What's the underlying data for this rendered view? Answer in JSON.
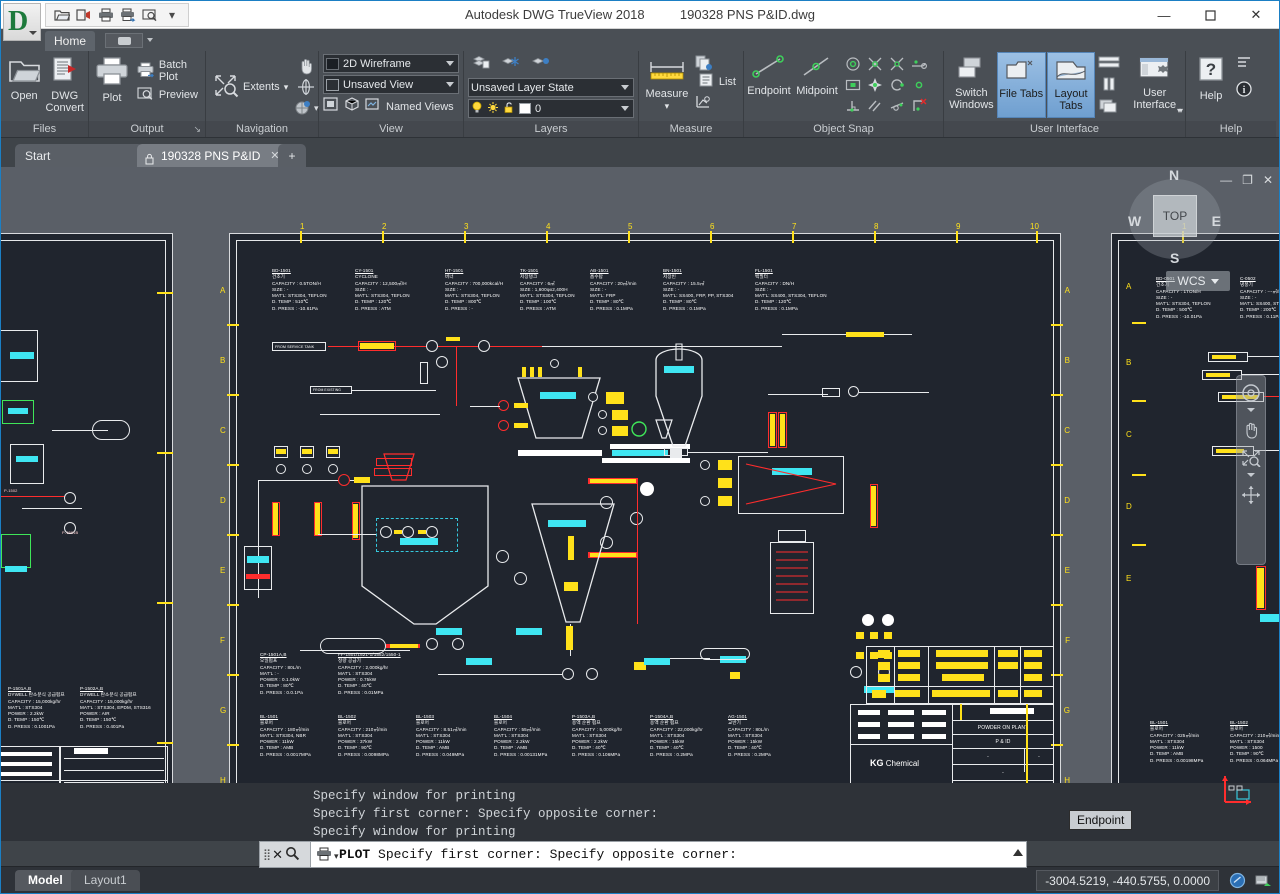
{
  "window": {
    "title": "Autodesk DWG TrueView 2018",
    "document": "190328 PNS P&ID.dwg",
    "minimize": "—",
    "maximize": "▢",
    "close": "✕"
  },
  "quick_access": {
    "icons": [
      {
        "name": "open-icon",
        "glyph": "🗁"
      },
      {
        "name": "edrawing-icon",
        "glyph": "▤"
      },
      {
        "name": "plot-icon",
        "glyph": "🖨"
      },
      {
        "name": "batch-plot-icon",
        "glyph": "🖶"
      },
      {
        "name": "preview-icon",
        "glyph": "🔍"
      },
      {
        "name": "qat-dropdown-icon",
        "glyph": "▾"
      }
    ]
  },
  "ribbon": {
    "tab_home": "Home",
    "panels": [
      {
        "title": "Files",
        "buttons": [
          {
            "label": "Open",
            "icon": "folder-open-icon"
          },
          {
            "label": "DWG\nConvert",
            "icon": "dwg-convert-icon"
          }
        ]
      },
      {
        "title": "Output",
        "buttons": [
          {
            "label": "Plot",
            "icon": "printer-icon"
          },
          {
            "label": "Batch Plot",
            "icon": "batch-plot-icon"
          },
          {
            "label": "Preview",
            "icon": "preview-icon"
          }
        ]
      },
      {
        "title": "Navigation",
        "buttons": [
          {
            "label": "Extents",
            "icon": "zoom-extents-icon"
          },
          {
            "label": "",
            "icon": "pan-hand-icon"
          },
          {
            "label": "",
            "icon": "orbit-icon"
          },
          {
            "label": "",
            "icon": "steering-wheel-icon"
          }
        ]
      },
      {
        "title": "View",
        "combos": [
          {
            "value": "2D Wireframe",
            "icon": "visual-style-icon"
          },
          {
            "value": "Unsaved View",
            "icon": "view-icon"
          }
        ],
        "buttons": [
          {
            "label": "Named Views",
            "icon": "named-views-icon"
          },
          {
            "label": "",
            "icon": "viewport-config-icon"
          },
          {
            "label": "",
            "icon": "isometric-icon"
          }
        ]
      },
      {
        "title": "Layers",
        "combos": [
          {
            "value": "Unsaved Layer State",
            "icon": "layer-state-icon"
          },
          {
            "value": "0",
            "icon": "layer-icon"
          }
        ],
        "buttons": [
          {
            "label": "",
            "icon": "layer-properties-icon"
          },
          {
            "label": "",
            "icon": "layer-freeze-icon"
          },
          {
            "label": "",
            "icon": "layer-off-icon"
          }
        ]
      },
      {
        "title": "Measure",
        "buttons": [
          {
            "label": "Measure",
            "icon": "measure-ruler-icon"
          },
          {
            "label": "List",
            "icon": "list-icon"
          },
          {
            "label": "",
            "icon": "copy-clip-icon"
          },
          {
            "label": "",
            "icon": "area-icon"
          }
        ]
      },
      {
        "title": "Object Snap",
        "buttons": [
          {
            "label": "Endpoint",
            "icon": "osnap-endpoint-icon"
          },
          {
            "label": "Midpoint",
            "icon": "osnap-midpoint-icon"
          },
          {
            "label": "",
            "icon": "osnap-center-icon"
          },
          {
            "label": "",
            "icon": "osnap-intersection-icon"
          },
          {
            "label": "",
            "icon": "osnap-apparent-intersection-icon"
          },
          {
            "label": "",
            "icon": "osnap-extension-icon"
          },
          {
            "label": "",
            "icon": "osnap-insertion-icon"
          },
          {
            "label": "",
            "icon": "osnap-node-icon"
          },
          {
            "label": "",
            "icon": "osnap-quadrant-icon"
          },
          {
            "label": "",
            "icon": "osnap-nearest-icon"
          },
          {
            "label": "",
            "icon": "osnap-perpendicular-icon"
          },
          {
            "label": "",
            "icon": "osnap-parallel-icon"
          },
          {
            "label": "",
            "icon": "osnap-tangent-icon"
          },
          {
            "label": "",
            "icon": "osnap-none-icon"
          }
        ]
      },
      {
        "title": "User Interface",
        "buttons": [
          {
            "label": "Switch\nWindows",
            "icon": "switch-windows-icon"
          },
          {
            "label": "File Tabs",
            "icon": "file-tabs-icon",
            "active": true
          },
          {
            "label": "Layout\nTabs",
            "icon": "layout-tabs-icon",
            "active": true
          },
          {
            "label": "User\nInterface",
            "icon": "user-interface-icon"
          },
          {
            "label": "",
            "icon": "command-line-icon"
          },
          {
            "label": "",
            "icon": "status-bar-icon"
          },
          {
            "label": "",
            "icon": "cascade-icon"
          }
        ]
      },
      {
        "title": "Help",
        "buttons": [
          {
            "label": "Help",
            "icon": "help-question-icon"
          },
          {
            "label": "",
            "icon": "about-info-icon"
          },
          {
            "label": "",
            "icon": "help-list-icon"
          }
        ]
      }
    ]
  },
  "file_tabs": [
    {
      "label": "Start",
      "active": false,
      "locked": false
    },
    {
      "label": "190328 PNS P&ID",
      "active": true,
      "locked": true,
      "close": "✕"
    },
    {
      "label": "+",
      "active": false,
      "locked": false
    }
  ],
  "drawing_window": {
    "minimize": "—",
    "restore": "❐",
    "close": "✕"
  },
  "viewcube": {
    "face": "TOP",
    "north": "N",
    "south": "S",
    "west": "W",
    "east": "E",
    "ucs": "WCS"
  },
  "navbar": {
    "items": [
      {
        "name": "steering-wheel-icon",
        "glyph": "◎"
      },
      {
        "name": "pan-icon",
        "glyph": "✋"
      },
      {
        "name": "zoom-icon",
        "glyph": "⌕"
      },
      {
        "name": "orbit-icon",
        "glyph": "✥"
      }
    ]
  },
  "tooltip": {
    "endpoint": "Endpoint"
  },
  "command_line": {
    "history": [
      "Specify window for printing",
      "Specify first corner: Specify opposite corner:",
      "Specify window for printing"
    ],
    "prompt_command": "PLOT",
    "prompt_text": "Specify first corner: Specify opposite corner:",
    "close_icon": "✕",
    "search_icon": "🔍",
    "app_icon": "🖨",
    "expand_icon": "▲"
  },
  "status_bar": {
    "model_tab": "Model",
    "layout_tab": "Layout1",
    "coordinates": "-3004.5219, -440.5755, 0.0000",
    "icons": [
      {
        "name": "customization-icon",
        "glyph": "◔"
      },
      {
        "name": "annotation-scale-icon",
        "glyph": "▥"
      }
    ]
  },
  "drawing": {
    "grid_labels_top": [
      "1",
      "2",
      "3",
      "4",
      "5",
      "6",
      "7",
      "8",
      "9",
      "10"
    ],
    "grid_labels_left": [
      "A",
      "B",
      "C",
      "D",
      "E",
      "F",
      "G",
      "H"
    ],
    "equipment_notes_top": [
      {
        "tag": "BD-1501",
        "name": "건조기",
        "lines": [
          "CAPACITY : 0.5TON/H",
          "SIZE : -",
          "MAT'L: STS304, TEFLON",
          "D. TEMP : 510℃",
          "D. PRESS : -10.61Pa"
        ]
      },
      {
        "tag": "CY-1501",
        "name": "CYCLONE",
        "lines": [
          "CAPACITY : 12,500㎥/H",
          "SIZE : -",
          "MAT'L: STS304, TEFLON",
          "D. TEMP : 120℃",
          "D. PRESS : ATM"
        ]
      },
      {
        "tag": "HT-1501",
        "name": "버너",
        "lines": [
          "CAPACITY : 700,000kcal/H",
          "SIZE : -",
          "MAT'L: STS304, TEFLON",
          "D. TEMP : 800℃",
          "D. PRESS : -"
        ]
      },
      {
        "tag": "TK-1501",
        "name": "저장탱크",
        "lines": [
          "CAPACITY : 6㎥",
          "SIZE : 1,600φx2,400H",
          "MAT'L: STS304, TEFLON",
          "D. TEMP : 100℃",
          "D. PRESS : ATM"
        ]
      },
      {
        "tag": "AB-1501",
        "name": "흡수탑",
        "lines": [
          "CAPACITY : 20㎥/min",
          "SIZE : -",
          "MAT'L: FRP",
          "D. TEMP : 80℃",
          "D. PRESS : 0.1MPa"
        ]
      },
      {
        "tag": "BN-1501",
        "name": "저장빈",
        "lines": [
          "CAPACITY : 15.5㎥",
          "SIZE : -",
          "MAT'L: SS400, FRP, PP, STS304",
          "D. TEMP : 80℃",
          "D. PRESS : 0.1MPa"
        ]
      },
      {
        "tag": "FL-1501",
        "name": "백필터",
        "lines": [
          "CAPACITY : DN/H",
          "SIZE : -",
          "MAT'L: SS400, STS304, TEFLON",
          "D. TEMP : 120℃",
          "D. PRESS : 0.1MPa"
        ]
      }
    ],
    "equipment_notes_bottom": [
      {
        "tag": "CP-1501A,B",
        "name": "오일펌프",
        "lines": [
          "CAPACITY : 80L/m",
          "MAT'L : -",
          "POWER : 0.1.0kW",
          "D. TEMP : 80℃",
          "D. PRESS : 0.0.1Pa"
        ]
      },
      {
        "tag": "FF-1501/1521-1/1552/1550-1",
        "name": "정량 공급기",
        "lines": [
          "CAPACITY : 2,000kg/hr",
          "MAT'L : STS304",
          "POWER : 0.75kW",
          "D. TEMP : 40℃",
          "D. PRESS : 0.01MPa"
        ]
      },
      {
        "tag": "BL-1501",
        "name": "블로어",
        "lines": [
          "CAPACITY : 180㎥/min",
          "MAT'L: STS304, NBR",
          "POWER : 11kW",
          "D. TEMP : AMB",
          "D. PRESS : 0.0017MPa"
        ]
      },
      {
        "tag": "BL-1502",
        "name": "블로어",
        "lines": [
          "CAPACITY : 210㎥/min",
          "MAT'L : STS304",
          "POWER : 37kW",
          "D. TEMP : 90℃",
          "D. PRESS : 0.0098MPa"
        ]
      },
      {
        "tag": "BL-1503",
        "name": "블로어",
        "lines": [
          "CAPACITY : 8.51㎥/min",
          "MAT'L : STS304",
          "POWER : 11kW",
          "D. TEMP : AMB",
          "D. PRESS : 0.049MPa"
        ]
      },
      {
        "tag": "BL-1504",
        "name": "블로어",
        "lines": [
          "CAPACITY : 55㎥/min",
          "MAT'L : STS304",
          "POWER : 2.2kW",
          "D. TEMP : AMB",
          "D. PRESS : 0.00131MPa"
        ]
      },
      {
        "tag": "P-1503A,B",
        "name": "용액 순환 펌프",
        "lines": [
          "CAPACITY : 5,000kg/hr",
          "MAT'L : STS304",
          "POWER : 2.2kW",
          "D. TEMP : 40℃",
          "D. PRESS : 0.106MPa"
        ]
      },
      {
        "tag": "P-1504A,B",
        "name": "용액 순환 펌프",
        "lines": [
          "CAPACITY : 22,000kg/hr",
          "MAT'L : STS304",
          "POWER : 15kW",
          "D. TEMP : 40℃",
          "D. PRESS : 0.2MPa"
        ]
      },
      {
        "tag": "AG-1501",
        "name": "교반기",
        "lines": [
          "CAPACITY : 80L/m",
          "MAT'L : STS304",
          "POWER : 15kW",
          "D. TEMP : 40℃",
          "D. PRESS : 0.2MPa"
        ]
      }
    ],
    "title_block": {
      "project": "POWDER ON PLANT",
      "drawing_type": "P & ID",
      "company": "Chemical",
      "company_mark": "KG"
    },
    "left_panel_notes": [
      {
        "tag": "P-1501A,B",
        "name": "DYWELL 탄소분식 공급펌프",
        "lines": [
          "CAPACITY : 15,000kg/hr",
          "MAT'L : STS304",
          "POWER : 2.2kW",
          "D. TEMP : 150℃",
          "D. PRESS : 0.1001Pa"
        ]
      },
      {
        "tag": "P-1502A,B",
        "name": "DYWELL 탄소분식 공급펌프",
        "lines": [
          "CAPACITY : 15,000kg/hr",
          "MAT'L : STS304, EPDM, STS316",
          "POWER : AIR",
          "D. TEMP : 150℃",
          "D. PRESS : 0.401Pa"
        ]
      }
    ],
    "right_panel_notes": [
      {
        "tag": "BD-0501",
        "name": "건조기",
        "lines": [
          "CAPACITY : 1TON/H",
          "SIZE : -",
          "MAT'L: STS304, TEFLON",
          "D. TEMP : 500℃",
          "D. PRESS : -10.01Pa"
        ]
      },
      {
        "tag": "C-0502",
        "name": "냉풍기",
        "lines": [
          "CAPACITY : ---㎥/H",
          "SIZE : -",
          "MAT'L: SS400, STS304",
          "D. TEMP : 200℃",
          "D. PRESS : 0.11Pa"
        ]
      },
      {
        "tag": "BL-1501",
        "name": "블로어",
        "lines": [
          "CAPACITY : 025㎥/min",
          "MAT'L : STS304",
          "POWER : 11kW",
          "D. TEMP : AMB",
          "D. PRESS : 0.00198MPa"
        ]
      },
      {
        "tag": "BL-1502",
        "name": "블로어",
        "lines": [
          "CAPACITY : 210㎥/min",
          "MAT'L : STS304",
          "POWER : 1500",
          "D. TEMP : 90℃",
          "D. PRESS : 0.064MPa"
        ]
      }
    ]
  }
}
